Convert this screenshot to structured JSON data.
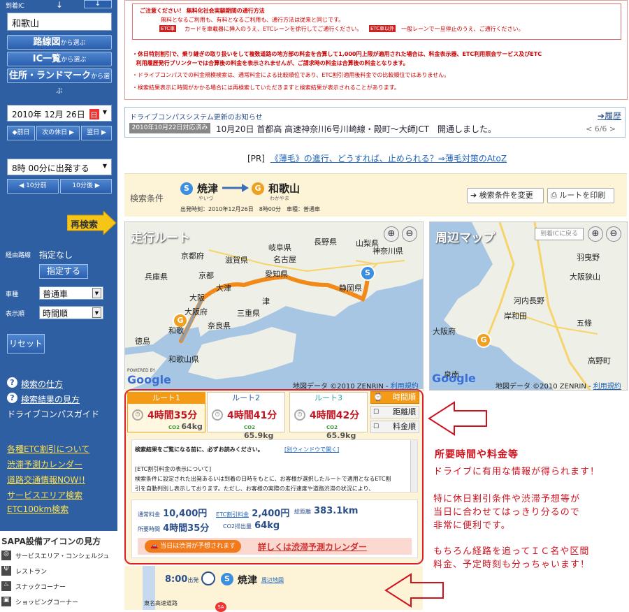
{
  "sidebar": {
    "dest_label": "到着IC",
    "dest_value": "和歌山",
    "btn_route": "路線図",
    "btn_route_sub": "から選ぶ",
    "btn_ic": "IC一覧",
    "btn_ic_sub": "から選ぶ",
    "btn_addr": "住所・ランドマーク",
    "btn_addr_sub": "から選ぶ",
    "date_value": "2010年 12月 26日",
    "date_day": "日",
    "prev_day": "◆前日",
    "next_holiday": "次の休日 ▶",
    "next_day": "翌日 ▶",
    "time_value": "8時 00分に出発する",
    "minus10": "◀ 10分前",
    "plus10": "10分後 ▶",
    "research": "再検索",
    "via_label": "経由路線",
    "via_value": "指定なし",
    "via_btn": "指定する",
    "car_label": "車種",
    "car_value": "普通車",
    "order_label": "表示順",
    "order_value": "時間順",
    "reset": "リセット",
    "help1": "検索の仕方",
    "help2": "検索結果の見方",
    "guide": "ドライブコンパスガイド",
    "ylinks": [
      "各種ETC割引について",
      "渋滞予測カレンダー",
      "道路交通情報NOW!!",
      "サービスエリア検索",
      "ETC100km検索"
    ],
    "sapa_title": "SAPA設備アイコンの見方",
    "sapa_items": [
      "サービスエリア・コンシェルジュ",
      "レストラン",
      "スナックコーナー",
      "ショッピングコーナー"
    ]
  },
  "notice": {
    "title": "ご注意ください！ 無料化社会実験期間の通行方法",
    "line1": "無料となるご利用も、有料となるご利用も、通行方法は従来と同じです。",
    "etc_tag": "ETC車",
    "line2": "カードを車載器に挿入のうえ、ETCレーンを徐行してご通行ください。",
    "general_tag": "ETC車以外",
    "line3": "一般レーンで一旦停止のうえ、ご通行ください。",
    "bullet1": "休日特別割引で、乗り継ぎの取り扱いをして複数道路の地方部の料金を合算して1,000円上限が適用された場合は、料金表示器、ETC利用照会サービス及びETC",
    "bullet1b": "利用履歴発行プリンターでは合算後の料金を表示されませんが、ご請求時の料金は合算後の料金となります。",
    "bullet2": "ドライブコンパスでの料金規模検索は、通常料金による比較順位であり、ETC割引適用後料金での比較順位ではありません。",
    "bullet3": "検索結果表示に時間がかかる場合には再検索していただきますと検索結果が表示されることがあります。"
  },
  "news": {
    "title": "ドライブコンパスシステム更新のお知らせ",
    "history": "履歴",
    "date_tag": "2010年10月22日対応済み",
    "text": "10月20日 首都高 高速神奈川6号川崎線・殿町〜大師JCT　開通しました。",
    "pager": "< 6/6 >"
  },
  "pr": {
    "label": "[PR]",
    "link": "《薄毛》の進行、どうすれば、止められる？⇒薄毛対策のAtoZ"
  },
  "search": {
    "cond_label": "検索条件",
    "from": "焼津",
    "from_kana": "やいづ",
    "to": "和歌山",
    "to_kana": "わかやま",
    "detail": "出発時刻：2010年12月26日　8時00分　車種：普通車",
    "change_btn": "検索条件を変更",
    "print_btn": "ルートを印刷"
  },
  "map1": {
    "title": "走行ルート",
    "credit": "地図データ ©2010 ZENRIN - ",
    "terms": "利用規約",
    "powered": "POWERED BY",
    "google": "Google",
    "labels": [
      "山梨県",
      "神奈川県",
      "長野県",
      "岐阜県",
      "京都府",
      "滋賀県",
      "愛知県",
      "静岡県",
      "兵庫県",
      "大阪",
      "三重県",
      "奈良県",
      "徳島",
      "和歌山県",
      "大阪府",
      "名古屋",
      "津",
      "京都",
      "大津",
      "和歌"
    ]
  },
  "map2": {
    "title": "周辺マップ",
    "back": "到着ICに戻る",
    "credit": "地図データ ©2010 ZENRIN - ",
    "terms": "利用規約",
    "google": "Google",
    "labels": [
      "大阪府",
      "羽曳野",
      "大阪狭山",
      "河内長野",
      "岸和田",
      "五條",
      "高野町",
      "泉南"
    ]
  },
  "routes": [
    {
      "name": "ルート1",
      "time": "4時間35分",
      "co2": "64kg",
      "selected": true
    },
    {
      "name": "ルート2",
      "time": "4時間41分",
      "co2": "65.9kg",
      "selected": false
    },
    {
      "name": "ルート3",
      "time": "4時間42分",
      "co2": "65.9kg",
      "selected": false
    }
  ],
  "sort": [
    "時間順",
    "距離順",
    "料金順"
  ],
  "disclaimer": {
    "head": "検索結果をご覧になる前に、必ずお読みください。",
    "link": "[別ウィンドウで開く]",
    "sub": "[ETC割引料金の表示について]",
    "body1": "検索条件に設定された出発あるいは到着の日時をもとに、お客様が選択したルートで適用となるETC割",
    "body2": "引を自動判別し表示しております。ただし、お客様の実際の走行速度や道路渋滞の状況により、"
  },
  "summary": {
    "normal_label": "通常料金",
    "normal": "10,400円",
    "etc_label": "ETC割引料金",
    "etc": "2,400円",
    "dist_label": "総距離",
    "dist": "383.1km",
    "time_label": "所要時間",
    "time": "4時間35分",
    "co2_label": "CO2排出量",
    "co2": "64kg",
    "jam_tag": "当日は渋滞が予想されます",
    "jam_link": "詳しくは渋滞予測カレンダー"
  },
  "timeline": {
    "time": "8:00",
    "dep": "出発",
    "name": "焼津",
    "map": "周辺地図",
    "road": "東名高速道路"
  },
  "annotation": {
    "title": "所要時間や料金等",
    "line1": "ドライブに有用な情報が得られます！",
    "line2": "特に休日割引条件や渋滞予想等が",
    "line3": "当日に合わせてはっきり分るので",
    "line4": "非常に便利です。",
    "line5": "もちろん経路を追ってＩＣ名や区間",
    "line6": "料金、予定時刻も分っちゃいます！"
  }
}
